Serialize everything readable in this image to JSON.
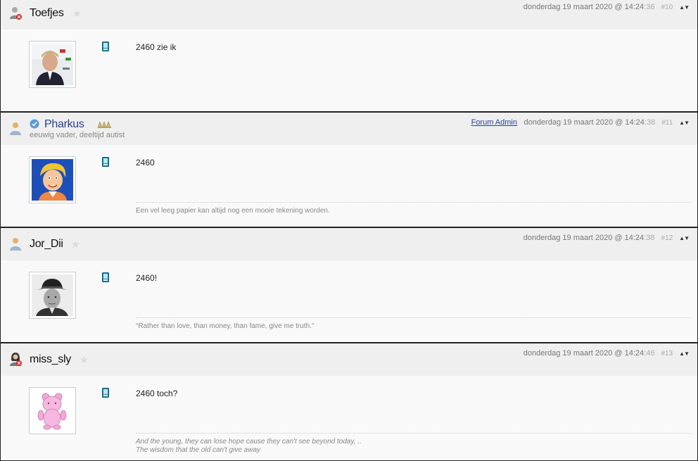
{
  "posts": [
    {
      "username": "Toefjes",
      "date": "donderdag 19 maart 2020 @ 14:24",
      "seconds": ":36",
      "number": "#10",
      "message": "2460 zie ik",
      "avatar_icon": "person-photo-avatar"
    },
    {
      "username": "Pharkus",
      "subtitle": "eeuwig vader, deeltijd autist",
      "role": "Forum Admin",
      "date": "donderdag 19 maart 2020 @ 14:24",
      "seconds": ":38",
      "number": "#11",
      "message": "2460",
      "signature": "Een vel leeg papier kan altijd nog een mooie tekening worden.",
      "avatar_icon": "cartoon-avatar"
    },
    {
      "username": "Jor_Dii",
      "date": "donderdag 19 maart 2020 @ 14:24",
      "seconds": ":38",
      "number": "#12",
      "message": "2460!",
      "signature": "“Rather than love, than money, than fame, give me truth.”",
      "avatar_icon": "man-with-hat-avatar"
    },
    {
      "username": "miss_sly",
      "date": "donderdag 19 maart 2020 @ 14:24",
      "seconds": ":46",
      "number": "#13",
      "message": "2460 toch?",
      "signature_lines": [
        "And the young, they can lose hope cause they can't see beyond today, ..",
        "The wisdom that the old can't give away"
      ],
      "avatar_icon": "pink-bear-avatar"
    }
  ],
  "colors": {
    "header_bg": "#efefef",
    "body_bg": "#f9f9f9",
    "admin_name": "#2a3f8f",
    "meta_text": "#777777"
  }
}
